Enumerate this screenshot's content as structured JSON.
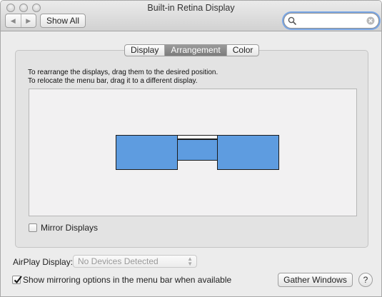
{
  "window": {
    "title": "Built-in Retina Display"
  },
  "toolbar": {
    "back_icon": "chevron-left-icon",
    "forward_icon": "chevron-right-icon",
    "show_all_label": "Show All",
    "search": {
      "value": "",
      "placeholder": ""
    }
  },
  "tabs": [
    {
      "label": "Display",
      "active": false
    },
    {
      "label": "Arrangement",
      "active": true
    },
    {
      "label": "Color",
      "active": false
    }
  ],
  "arrangement": {
    "instructions_line1": "To rearrange the displays, drag them to the desired position.",
    "instructions_line2": "To relocate the menu bar, drag it to a different display.",
    "display_color": "#5e9ce0",
    "mirror_displays": {
      "label": "Mirror Displays",
      "checked": false
    }
  },
  "airplay": {
    "label": "AirPlay Display:",
    "selected": "No Devices Detected",
    "enabled": false
  },
  "show_mirroring": {
    "label": "Show mirroring options in the menu bar when available",
    "checked": true
  },
  "gather_windows_label": "Gather Windows",
  "help_label": "?"
}
